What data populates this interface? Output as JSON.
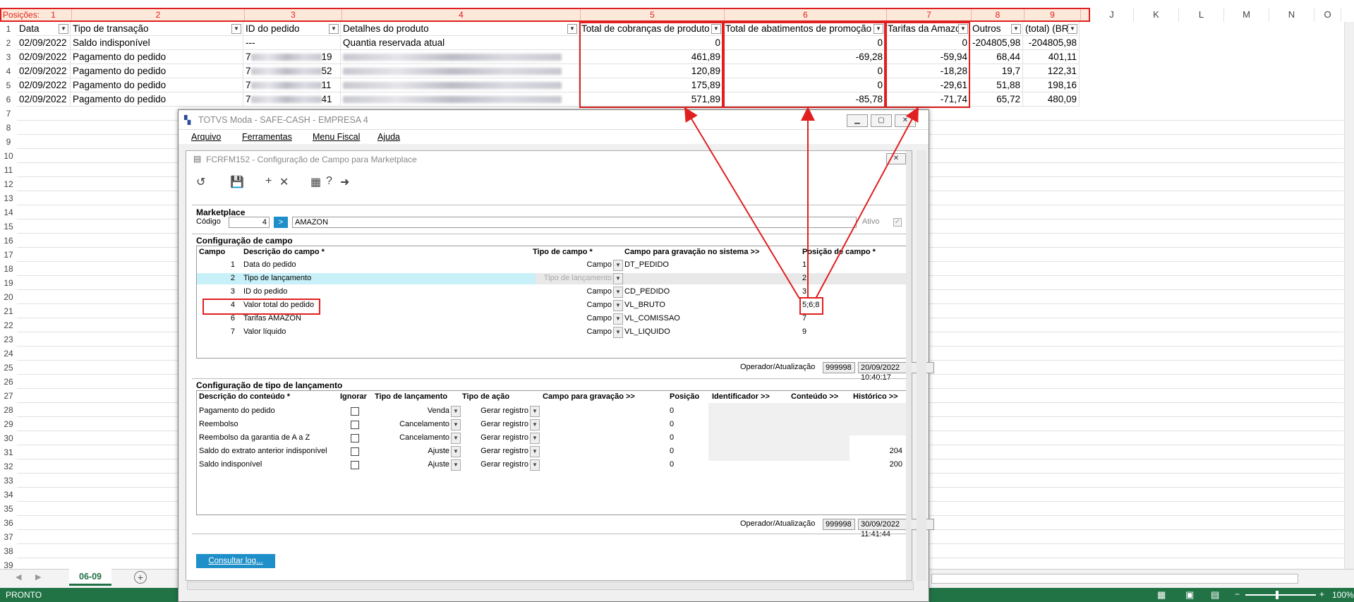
{
  "sheet": {
    "positions_label": "Posições:",
    "positions": [
      "1",
      "2",
      "3",
      "4",
      "5",
      "6",
      "7",
      "8",
      "9"
    ],
    "col_letters": [
      "J",
      "K",
      "L",
      "M",
      "N",
      "O"
    ],
    "headers": [
      "Data",
      "Tipo de transação",
      "ID do pedido",
      "Detalhes do produto",
      "Total de cobranças de produto",
      "Total de abatimentos de promoção",
      "Tarifas da Amazon",
      "Outros",
      "(total) (BRL)"
    ],
    "rows": [
      {
        "n": "2",
        "data": "02/09/2022",
        "tipo": "Saldo indisponível",
        "id": "---",
        "det": "Quantia reservada atual",
        "c5": "0",
        "c6": "0",
        "c7": "0",
        "c8": "-204805,98",
        "c9": "-204805,98"
      },
      {
        "n": "3",
        "data": "02/09/2022",
        "tipo": "Pagamento do pedido",
        "id": "7",
        "id_end": "19",
        "det": "",
        "c5": "461,89",
        "c6": "-69,28",
        "c7": "-59,94",
        "c8": "68,44",
        "c9": "401,11"
      },
      {
        "n": "4",
        "data": "02/09/2022",
        "tipo": "Pagamento do pedido",
        "id": "7",
        "id_end": "52",
        "det": "",
        "c5": "120,89",
        "c6": "0",
        "c7": "-18,28",
        "c8": "19,7",
        "c9": "122,31"
      },
      {
        "n": "5",
        "data": "02/09/2022",
        "tipo": "Pagamento do pedido",
        "id": "7",
        "id_end": "11",
        "det": "",
        "c5": "175,89",
        "c6": "0",
        "c7": "-29,61",
        "c8": "51,88",
        "c9": "198,16"
      },
      {
        "n": "6",
        "data": "02/09/2022",
        "tipo": "Pagamento do pedido",
        "id": "7",
        "id_end": "41",
        "det": "",
        "c5": "571,89",
        "c6": "-85,78",
        "c7": "-71,74",
        "c8": "65,72",
        "c9": "480,09"
      }
    ],
    "row_numbers": [
      "7",
      "8",
      "9",
      "10",
      "11",
      "12",
      "13",
      "14",
      "15",
      "16",
      "17",
      "18",
      "19",
      "20",
      "21",
      "22",
      "23",
      "24",
      "25",
      "26",
      "27",
      "28",
      "29",
      "30",
      "31",
      "32",
      "33",
      "34",
      "35",
      "36",
      "37",
      "38",
      "39"
    ],
    "first_row_number": "1",
    "sheet_tab": "06-09",
    "status_text": "PRONTO",
    "zoom": "100%"
  },
  "window": {
    "title": "TOTVS Moda - SAFE-CASH - EMPRESA 4",
    "menu": [
      "Arquivo",
      "Ferramentas",
      "Menu Fiscal",
      "Ajuda"
    ],
    "form_title": "FCRFM152 - Configuração de Campo para Marketplace",
    "marketplace_title": "Marketplace",
    "codigo_label": "Código",
    "codigo_value": "4",
    "marketplace_name": "AMAZON",
    "ativo_label": "Ativo",
    "campo_section": "Configuração de campo",
    "campo_headers": [
      "Campo",
      "Descrição do campo *",
      "Tipo de campo *",
      "Campo para gravação no sistema >>",
      "Posição de campo *"
    ],
    "campo_rows": [
      {
        "n": "1",
        "desc": "Data do pedido",
        "tipo": "Campo",
        "grav": "DT_PEDIDO",
        "pos": "1"
      },
      {
        "n": "2",
        "desc": "Tipo de lançamento",
        "tipo": "Tipo de lançamento",
        "grav": "",
        "pos": "2"
      },
      {
        "n": "3",
        "desc": "ID do pedido",
        "tipo": "Campo",
        "grav": "CD_PEDIDO",
        "pos": "3"
      },
      {
        "n": "4",
        "desc": "Valor total do pedido",
        "tipo": "Campo",
        "grav": "VL_BRUTO",
        "pos": "5;6;8"
      },
      {
        "n": "6",
        "desc": "Tarifas AMAZON",
        "tipo": "Campo",
        "grav": "VL_COMISSAO",
        "pos": "7"
      },
      {
        "n": "7",
        "desc": "Valor líquido",
        "tipo": "Campo",
        "grav": "VL_LIQUIDO",
        "pos": "9"
      }
    ],
    "operador_label": "Operador/Atualização",
    "operador1": "999998",
    "data1": "20/09/2022 10:40:17",
    "lanc_section": "Configuração de tipo de lançamento",
    "lanc_headers": [
      "Descrição do conteúdo *",
      "Ignorar",
      "Tipo de lançamento",
      "Tipo de ação",
      "Campo para gravação >>",
      "Posição",
      "Identificador >>",
      "Conteúdo >>",
      "Histórico >>"
    ],
    "lanc_rows": [
      {
        "desc": "Pagamento do pedido",
        "tipo": "Venda",
        "acao": "Gerar registro",
        "pos": "0",
        "hist": ""
      },
      {
        "desc": "Reembolso",
        "tipo": "Cancelamento",
        "acao": "Gerar registro",
        "pos": "0",
        "hist": ""
      },
      {
        "desc": "Reembolso da garantia de A a Z",
        "tipo": "Cancelamento",
        "acao": "Gerar registro",
        "pos": "0",
        "hist": ""
      },
      {
        "desc": "Saldo do extrato anterior indisponível",
        "tipo": "Ajuste",
        "acao": "Gerar registro",
        "pos": "0",
        "hist": "204"
      },
      {
        "desc": "Saldo indisponível",
        "tipo": "Ajuste",
        "acao": "Gerar registro",
        "pos": "0",
        "hist": "200"
      }
    ],
    "operador2": "999998",
    "data2": "30/09/2022 11:41:44",
    "consult_button": "Consultar log..."
  },
  "colors": {
    "accent_red": "#e02020",
    "excel_green": "#217346",
    "button_blue": "#1e8fc8",
    "highlight_row": "#c8f0f8"
  }
}
